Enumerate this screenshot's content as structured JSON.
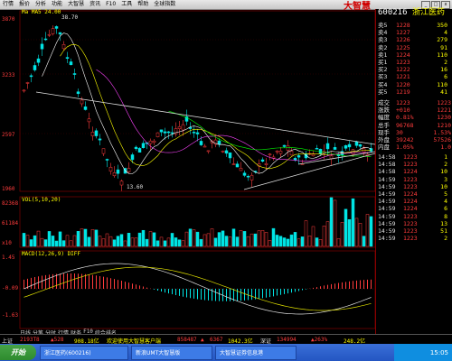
{
  "menubar": {
    "items": [
      "行情",
      "报价",
      "分析",
      "功能",
      "大智慧",
      "资讯",
      "F10",
      "工具",
      "帮助",
      "全球指数"
    ],
    "logo": "大智慧"
  },
  "main_chart": {
    "header": "Ma MA5 24.00",
    "price_labels": [
      "3870",
      "3233",
      "2597",
      "1960"
    ],
    "annotations": {
      "high": "38.70",
      "low": "13.60"
    }
  },
  "volume": {
    "header": "VOL(5,10,20)",
    "labels": [
      "82368",
      "61184",
      "x10"
    ]
  },
  "macd": {
    "header": "MACD(12,26,9) DIFF",
    "labels": [
      "1.45",
      "-0.09",
      "-1.63"
    ]
  },
  "bottom_tabs": [
    "日线",
    "分笔",
    "分时",
    "行情",
    "财务",
    "F10",
    "综合排名"
  ],
  "right_panel": {
    "code": "600216",
    "name": "浙江医药",
    "order_rows": [
      {
        "label": "卖5",
        "price": "1228",
        "vol": "350"
      },
      {
        "label": "卖4",
        "price": "1227",
        "vol": "4"
      },
      {
        "label": "卖3",
        "price": "1226",
        "vol": "279"
      },
      {
        "label": "卖2",
        "price": "1225",
        "vol": "91"
      },
      {
        "label": "卖1",
        "price": "1224",
        "vol": "110"
      },
      {
        "label": "买1",
        "price": "1223",
        "vol": "2"
      },
      {
        "label": "买2",
        "price": "1222",
        "vol": "16"
      },
      {
        "label": "买3",
        "price": "1221",
        "vol": "6"
      },
      {
        "label": "买4",
        "price": "1220",
        "vol": "110"
      },
      {
        "label": "买5",
        "price": "1219",
        "vol": "41"
      }
    ],
    "stats": [
      {
        "l": "成交",
        "v": "1223",
        "r": "1223"
      },
      {
        "l": "涨跌",
        "v": "+010",
        "r": "1221"
      },
      {
        "l": "幅度",
        "v": "0.81%",
        "r": "1230"
      },
      {
        "l": "总手",
        "v": "96768",
        "r": "1210"
      },
      {
        "l": "现手",
        "v": "30",
        "r": "1.53%"
      },
      {
        "l": "外盘",
        "v": "39242",
        "r": "57526"
      },
      {
        "l": "内盘",
        "v": "1.05%",
        "r": "1.0"
      }
    ],
    "ticks": [
      {
        "t": "14:58",
        "p": "1223",
        "v": "1"
      },
      {
        "t": "14:58",
        "p": "1223",
        "v": "2"
      },
      {
        "t": "14:58",
        "p": "1224",
        "v": "10"
      },
      {
        "t": "14:59",
        "p": "1223",
        "v": "3"
      },
      {
        "t": "14:59",
        "p": "1223",
        "v": "10"
      },
      {
        "t": "14:59",
        "p": "1224",
        "v": "5"
      },
      {
        "t": "14:59",
        "p": "1224",
        "v": "4"
      },
      {
        "t": "14:59",
        "p": "1224",
        "v": "6"
      },
      {
        "t": "14:59",
        "p": "1223",
        "v": "8"
      },
      {
        "t": "14:59",
        "p": "1223",
        "v": "13"
      },
      {
        "t": "14:59",
        "p": "1223",
        "v": "51"
      },
      {
        "t": "14:59",
        "p": "1223",
        "v": "2"
      }
    ]
  },
  "statusbar": {
    "items": [
      "上证",
      "2193T8",
      "▲528",
      "908.18亿",
      "欢迎使用大智慧客户端",
      "858487",
      "▲",
      "6367",
      "1042.3亿",
      "深证",
      "134994",
      "▲263%",
      "248.2亿"
    ]
  },
  "taskbar": {
    "start": "开始",
    "items": [
      "浙江医药(600216)",
      "新浪UMT大智慧版",
      "大智慧证券信息港"
    ],
    "time": "15:05"
  },
  "colors": {
    "up": "#ff3c3c",
    "down": "#00e4e4",
    "bg": "#000000"
  }
}
